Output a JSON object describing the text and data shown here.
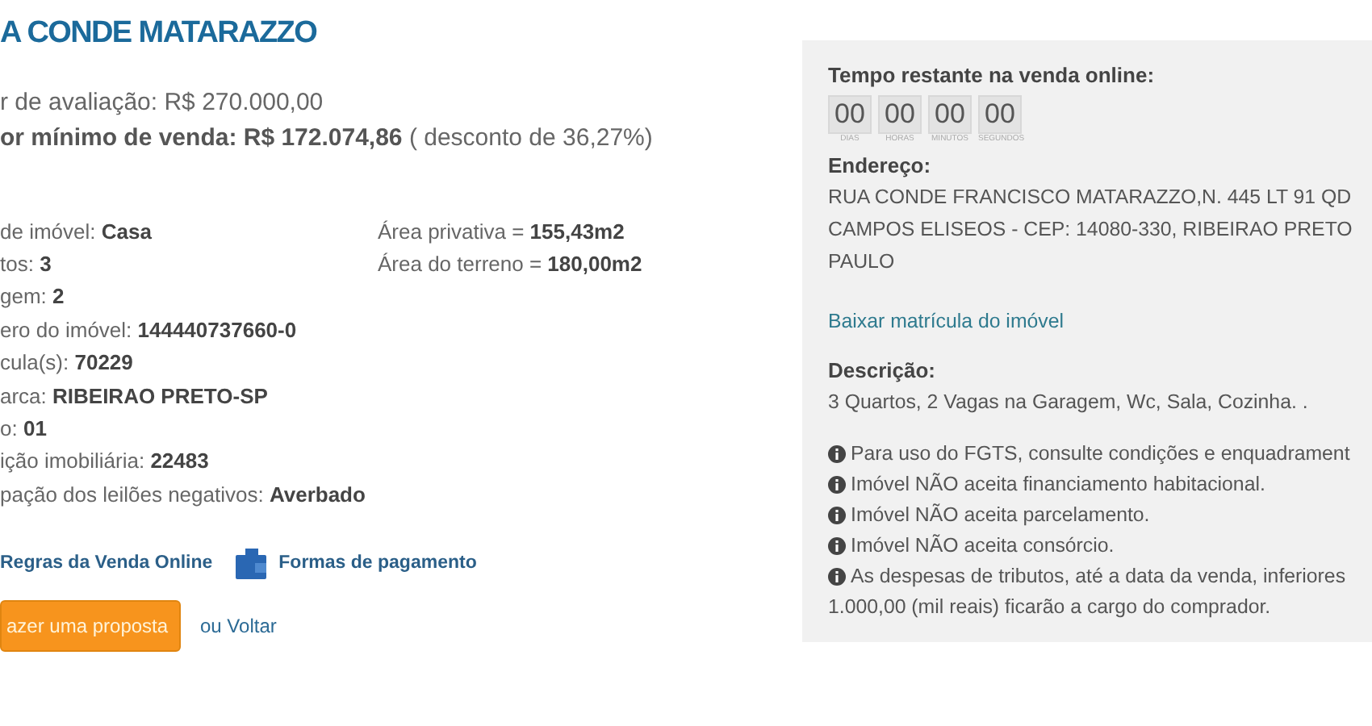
{
  "title": "A CONDE MATARAZZO",
  "prices": [
    "r de avaliação: R$ 270.000,00",
    "**or mínimo de venda: R$ 172.074,86** ( desconto de 36,27%)"
  ],
  "details_left": [
    {
      "label": "de imóvel:",
      "value": "Casa"
    },
    {
      "label": "tos:",
      "value": "3"
    },
    {
      "label": "gem:",
      "value": "2"
    },
    {
      "label": "ero do imóvel:",
      "value": "144440737660-0"
    },
    {
      "label": "cula(s):",
      "value": "70229"
    },
    {
      "label": "arca:",
      "value": "RIBEIRAO PRETO-SP"
    },
    {
      "label": "o:",
      "value": "01"
    },
    {
      "label": "ição imobiliária:",
      "value": "22483"
    },
    {
      "label": "pação dos leilões negativos:",
      "value": "Averbado"
    }
  ],
  "details_right": [
    {
      "label": "Área privativa =",
      "value": "155,43m2"
    },
    {
      "label": "Área do terreno =",
      "value": "180,00m2"
    }
  ],
  "links": [
    {
      "kind": "plain",
      "label": "Regras da Venda Online"
    },
    {
      "kind": "wallet",
      "label": "Formas de pagamento"
    }
  ],
  "proposal_button": "azer uma proposta",
  "back_link": "ou Voltar",
  "panel": {
    "countdown_title": "Tempo restante na venda online:",
    "countdown": [
      {
        "value": "00",
        "unit": "DIAS"
      },
      {
        "value": "00",
        "unit": "HORAS"
      },
      {
        "value": "00",
        "unit": "MINUTOS"
      },
      {
        "value": "00",
        "unit": "SEGUNDOS"
      }
    ],
    "address_title": "Endereço:",
    "address_lines": [
      "RUA CONDE FRANCISCO MATARAZZO,N. 445 LT 91 QD",
      "CAMPOS ELISEOS - CEP: 14080-330, RIBEIRAO PRETO",
      "PAULO"
    ],
    "download_link": "Baixar matrícula do imóvel",
    "description_title": "Descrição:",
    "description": "3 Quartos, 2 Vagas na Garagem, Wc, Sala, Cozinha. .",
    "notes": [
      {
        "lines": [
          "Para uso do FGTS, consulte condições e enquadrament"
        ]
      },
      {
        "lines": [
          "Imóvel NÃO aceita financiamento habitacional."
        ]
      },
      {
        "lines": [
          "Imóvel NÃO aceita parcelamento."
        ]
      },
      {
        "lines": [
          "Imóvel NÃO aceita consórcio."
        ]
      },
      {
        "lines": [
          "As despesas de tributos, até a data da venda, inferiores",
          "1.000,00 (mil reais) ficarão a cargo do comprador."
        ]
      }
    ]
  }
}
